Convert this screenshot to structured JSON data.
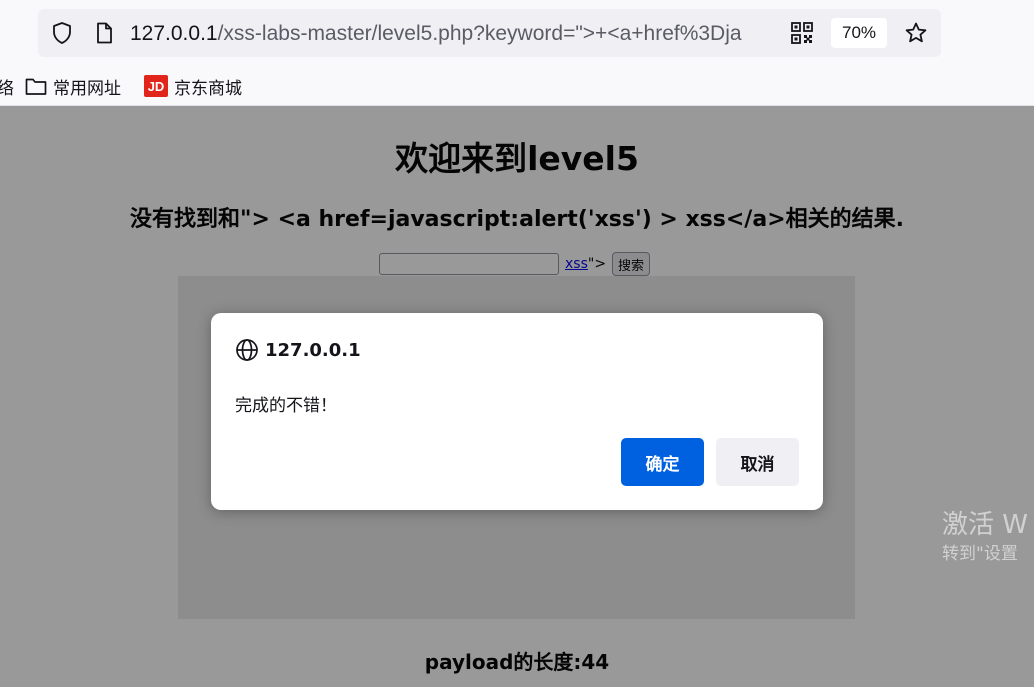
{
  "browser": {
    "url_host": "127.0.0.1",
    "url_path": "/xss-labs-master/level5.php?keyword=\">+<a+href%3Dja",
    "zoom": "70%",
    "icons": [
      "shield-icon",
      "page-icon",
      "qr-code-icon",
      "star-icon"
    ]
  },
  "bookmarks": {
    "partial_label": "络",
    "items": [
      {
        "label": "常用网址",
        "icon": "folder-icon"
      },
      {
        "label": "京东商城",
        "icon": "jd-logo-icon",
        "logo_text": "JD",
        "logo_color": "#e1251b"
      }
    ]
  },
  "page": {
    "title": "欢迎来到level5",
    "result_text": "没有找到和\"> <a href=javascript:alert('xss') > xss</a>相关的结果.",
    "search": {
      "input_value": "",
      "injected_link_text": "xss",
      "after_text": "\">",
      "button_label": "搜索"
    },
    "payload_length": "payload的长度:44"
  },
  "dialog": {
    "origin": "127.0.0.1",
    "message": "完成的不错！",
    "ok_label": "确定",
    "cancel_label": "取消",
    "ok_color": "#0061e0"
  },
  "watermark": {
    "line1": "激活 W",
    "line2": "转到\"设置"
  }
}
